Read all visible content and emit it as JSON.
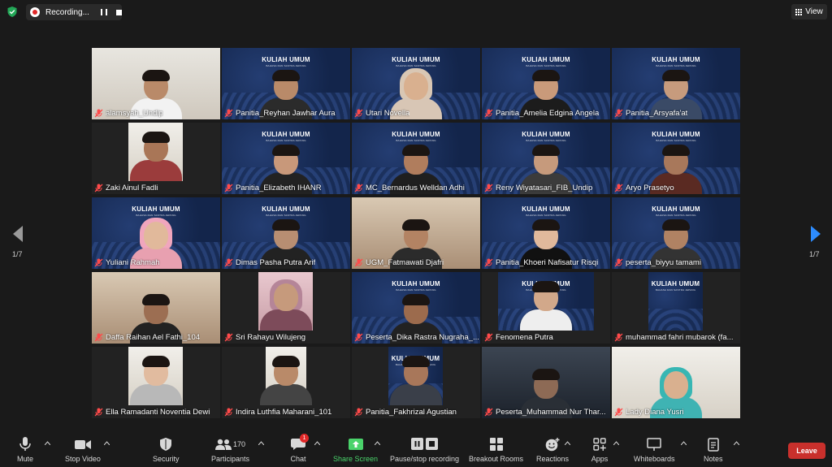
{
  "recording": {
    "label": "Recording..."
  },
  "view_button": {
    "label": "View"
  },
  "pager": {
    "left": "1/7",
    "right": "1/7"
  },
  "tiles": [
    {
      "name": "alamsyah_Undip"
    },
    {
      "name": "Panitia_Reyhan Jawhar Aura"
    },
    {
      "name": "Utari Novella"
    },
    {
      "name": "Panitia_Amelia Edgina Angela"
    },
    {
      "name": "Panitia_Arsyafa'at"
    },
    {
      "name": "Zaki Ainul Fadli"
    },
    {
      "name": "Panitia_Elizabeth IHANR"
    },
    {
      "name": "MC_Bernardus Welldan Adhi"
    },
    {
      "name": "Reny Wiyatasari_FIB_Undip"
    },
    {
      "name": "Aryo Prasetyo"
    },
    {
      "name": "Yuliani Rahmah"
    },
    {
      "name": "Dimas Pasha Putra Arif"
    },
    {
      "name": "UGM_Fatmawati Djafri"
    },
    {
      "name": "Panitia_Khoeri Nafisatur Risqi"
    },
    {
      "name": "peserta_biyyu tamami"
    },
    {
      "name": "Daffa Raihan Ael Fathi_104"
    },
    {
      "name": "Sri Rahayu Wilujeng"
    },
    {
      "name": "Peserta_Dika Rastra Nugraha_..."
    },
    {
      "name": "Fenomena Putra"
    },
    {
      "name": "muhammad fahri mubarok (fa..."
    },
    {
      "name": "Ella Ramadanti Noventia Dewi"
    },
    {
      "name": "Indira Luthfia Maharani_101"
    },
    {
      "name": "Panitia_Fakhrizal Agustian"
    },
    {
      "name": "Peserta_Muhammad Nur Thar..."
    },
    {
      "name": "Lady Diana Yusri"
    }
  ],
  "banner": {
    "title": "KULIAH UMUM",
    "subtitle": "BAHASA DAN SASTRA JEPANG"
  },
  "toolbar": {
    "mute": "Mute",
    "stop_video": "Stop Video",
    "security": "Security",
    "participants": "Participants",
    "participants_count": "170",
    "chat": "Chat",
    "chat_badge": "1",
    "share_screen": "Share Screen",
    "pause_recording": "Pause/stop recording",
    "breakout_rooms": "Breakout Rooms",
    "reactions": "Reactions",
    "apps": "Apps",
    "whiteboards": "Whiteboards",
    "notes": "Notes",
    "leave": "Leave"
  },
  "colors": {
    "active_speaker": "#d3e06a",
    "leave": "#c9302c",
    "share_green": "#4ad36b",
    "recording_red": "#e02828"
  }
}
